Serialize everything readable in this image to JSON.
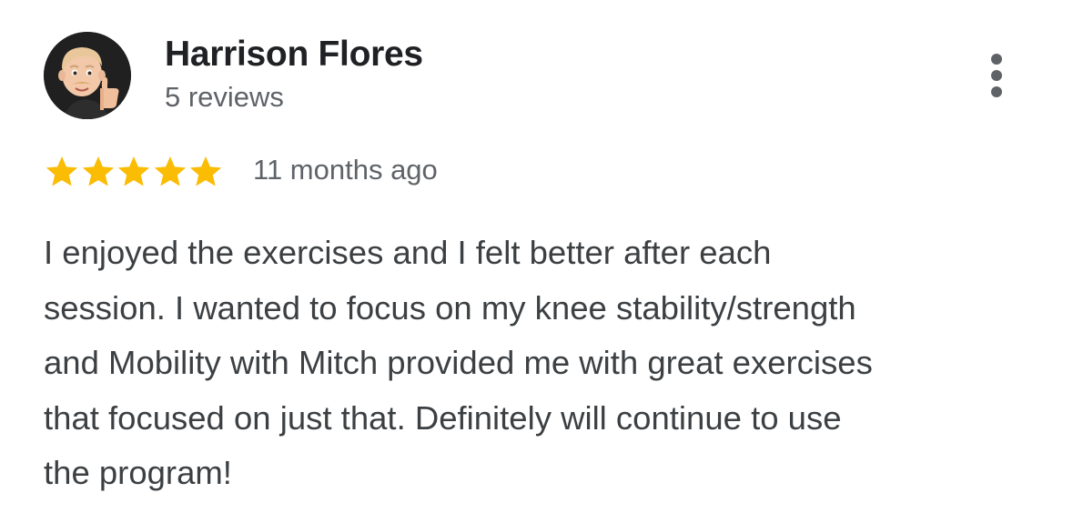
{
  "review": {
    "reviewer_name": "Harrison Flores",
    "review_count": "5 reviews",
    "avatar_icon": "memoji-thumbs-up-avatar",
    "menu_icon": "more-vert-icon",
    "rating": 5,
    "rating_max": 5,
    "star_color": "#FBBC04",
    "time": "11 months ago",
    "text_lines": [
      "I enjoyed the exercises and I felt better after each",
      "session. I wanted to focus on my knee stability/strength",
      "and Mobility with Mitch provided me with great exercises",
      "that focused on just that. Definitely will continue to use",
      "the program!"
    ]
  }
}
